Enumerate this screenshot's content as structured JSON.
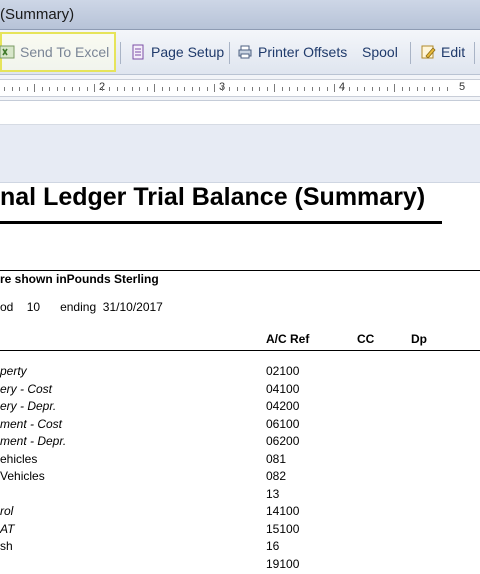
{
  "window": {
    "title": "(Summary)"
  },
  "toolbar": {
    "send_to_excel": "Send To Excel",
    "page_setup": "Page Setup",
    "printer_offsets": "Printer Offsets",
    "spool": "Spool",
    "edit": "Edit"
  },
  "ruler": {
    "numbers": [
      "2",
      "3",
      "4",
      "5"
    ]
  },
  "report": {
    "title": "nal Ledger Trial Balance (Summary)",
    "currency_note": "re shown inPounds Sterling",
    "period_label": "od",
    "period_value": "10",
    "ending_label": "ending",
    "ending_date": "31/10/2017",
    "columns": {
      "ac_ref": "A/C Ref",
      "cc": "CC",
      "dp": "Dp"
    },
    "rows": [
      {
        "name": "perty",
        "ref": "02100",
        "italic": true
      },
      {
        "name": "ery - Cost",
        "ref": "04100",
        "italic": true
      },
      {
        "name": "ery - Depr.",
        "ref": "04200",
        "italic": true
      },
      {
        "name": "ment - Cost",
        "ref": "06100",
        "italic": true
      },
      {
        "name": "ment - Depr.",
        "ref": "06200",
        "italic": true
      },
      {
        "name": "ehicles",
        "ref": "081",
        "italic": false
      },
      {
        "name": "Vehicles",
        "ref": "082",
        "italic": false
      },
      {
        "name": "",
        "ref": "13",
        "italic": false
      },
      {
        "name": "rol",
        "ref": "14100",
        "italic": true
      },
      {
        "name": "AT",
        "ref": "15100",
        "italic": true
      },
      {
        "name": "sh",
        "ref": "16",
        "italic": false
      },
      {
        "name": "",
        "ref": "19100",
        "italic": false
      }
    ]
  }
}
